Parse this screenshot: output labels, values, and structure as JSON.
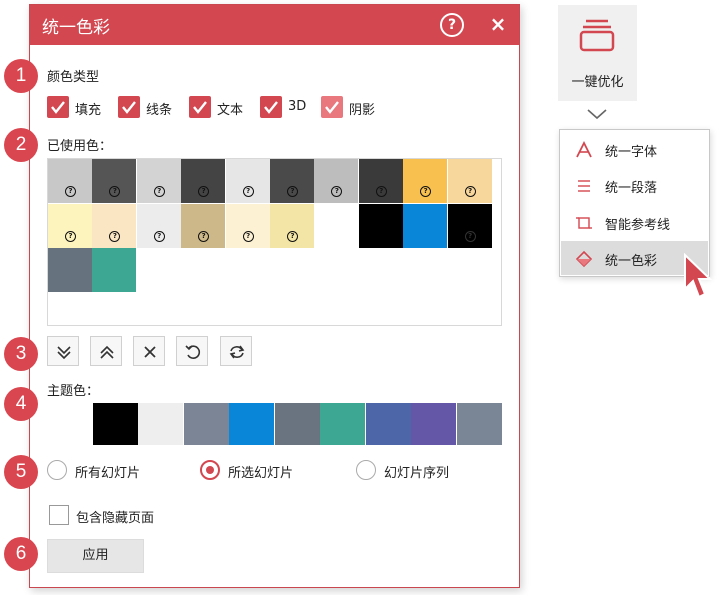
{
  "dialog": {
    "title": "统一色彩",
    "help_icon": "?",
    "close_icon": "×"
  },
  "steps": [
    "1",
    "2",
    "3",
    "4",
    "5",
    "6"
  ],
  "color_types": {
    "label": "颜色类型",
    "items": [
      {
        "label": "填充",
        "checked": true
      },
      {
        "label": "线条",
        "checked": true
      },
      {
        "label": "文本",
        "checked": true
      },
      {
        "label": "3D",
        "checked": true
      },
      {
        "label": "阴影",
        "checked": true,
        "light": true
      }
    ]
  },
  "used_colors": {
    "label": "已使用色：",
    "swatches": [
      {
        "color": "#c8c8c8",
        "mark": true
      },
      {
        "color": "#555555",
        "mark": true
      },
      {
        "color": "#d3d3d3",
        "mark": true
      },
      {
        "color": "#444444",
        "mark": true
      },
      {
        "color": "#e6e6e6",
        "mark": true
      },
      {
        "color": "#4a4a4a",
        "mark": true
      },
      {
        "color": "#bdbdbd",
        "mark": true
      },
      {
        "color": "#3a3a3a",
        "mark": true
      },
      {
        "color": "#f8c14f",
        "mark": true
      },
      {
        "color": "#f7d79c",
        "mark": true
      },
      {
        "color": "#fdf3bd",
        "mark": true
      },
      {
        "color": "#fbe6c4",
        "mark": true
      },
      {
        "color": "#ececec",
        "mark": true
      },
      {
        "color": "#cdb889",
        "mark": true
      },
      {
        "color": "#fdf1d4",
        "mark": true
      },
      {
        "color": "#f3e5a6",
        "mark": true
      },
      {
        "color": "#ffffff",
        "mark": false
      },
      {
        "color": "#000000",
        "mark": false
      },
      {
        "color": "#0a86d8",
        "mark": false
      },
      {
        "color": "#000000",
        "mark": true
      },
      {
        "color": "#66727d",
        "mark": false
      },
      {
        "color": "#3ea793",
        "mark": false
      }
    ],
    "mark_text": "?"
  },
  "toolbar": {
    "buttons": [
      {
        "name": "move-down-button",
        "icon": "double-chevron-down-icon"
      },
      {
        "name": "move-up-button",
        "icon": "double-chevron-up-icon"
      },
      {
        "name": "delete-button",
        "icon": "x-icon"
      },
      {
        "name": "undo-button",
        "icon": "undo-icon"
      },
      {
        "name": "refresh-button",
        "icon": "refresh-icon"
      }
    ]
  },
  "theme_colors": {
    "label": "主题色：",
    "colors": [
      "#ffffff",
      "#000000",
      "#eeeeee",
      "#7b8595",
      "#0a86d8",
      "#697480",
      "#3ea793",
      "#4d66a8",
      "#6557a7",
      "#7a8596"
    ]
  },
  "scope": {
    "options": [
      {
        "label": "所有幻灯片",
        "selected": false
      },
      {
        "label": "所选幻灯片",
        "selected": true
      },
      {
        "label": "幻灯片序列",
        "selected": false
      }
    ]
  },
  "include_hidden": {
    "label": "包含隐藏页面",
    "checked": false
  },
  "apply_label": "应用",
  "ribbon": {
    "button_label": "一键优化",
    "accent": "#d24750"
  },
  "menu": {
    "items": [
      {
        "label": "统一字体",
        "icon": "font-a-icon"
      },
      {
        "label": "统一段落",
        "icon": "paragraph-lines-icon"
      },
      {
        "label": "智能参考线",
        "icon": "guides-icon"
      },
      {
        "label": "统一色彩",
        "icon": "color-diamond-icon",
        "selected": true
      }
    ]
  }
}
